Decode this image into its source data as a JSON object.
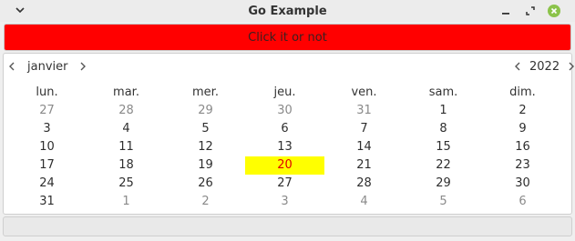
{
  "window": {
    "title": "Go Example"
  },
  "button": {
    "label": "Click it or not",
    "color": "#ff0000"
  },
  "calendar": {
    "month": "janvier",
    "year": "2022",
    "weekdays": [
      "lun.",
      "mar.",
      "mer.",
      "jeu.",
      "ven.",
      "sam.",
      "dim."
    ],
    "weeks": [
      [
        {
          "d": "27",
          "o": true
        },
        {
          "d": "28",
          "o": true
        },
        {
          "d": "29",
          "o": true
        },
        {
          "d": "30",
          "o": true
        },
        {
          "d": "31",
          "o": true
        },
        {
          "d": "1"
        },
        {
          "d": "2"
        }
      ],
      [
        {
          "d": "3"
        },
        {
          "d": "4"
        },
        {
          "d": "5"
        },
        {
          "d": "6"
        },
        {
          "d": "7"
        },
        {
          "d": "8"
        },
        {
          "d": "9"
        }
      ],
      [
        {
          "d": "10"
        },
        {
          "d": "11"
        },
        {
          "d": "12"
        },
        {
          "d": "13"
        },
        {
          "d": "14"
        },
        {
          "d": "15"
        },
        {
          "d": "16"
        }
      ],
      [
        {
          "d": "17"
        },
        {
          "d": "18"
        },
        {
          "d": "19"
        },
        {
          "d": "20",
          "today": true
        },
        {
          "d": "21"
        },
        {
          "d": "22"
        },
        {
          "d": "23"
        }
      ],
      [
        {
          "d": "24"
        },
        {
          "d": "25"
        },
        {
          "d": "26"
        },
        {
          "d": "27"
        },
        {
          "d": "28"
        },
        {
          "d": "29"
        },
        {
          "d": "30"
        }
      ],
      [
        {
          "d": "31"
        },
        {
          "d": "1",
          "o": true
        },
        {
          "d": "2",
          "o": true
        },
        {
          "d": "3",
          "o": true
        },
        {
          "d": "4",
          "o": true
        },
        {
          "d": "5",
          "o": true
        },
        {
          "d": "6",
          "o": true
        }
      ]
    ],
    "today_color": "#ffff00",
    "today_text_color": "#e00000"
  },
  "icons": {
    "menu": "chevron-down-icon",
    "minimize": "minimize-icon",
    "restore": "restore-icon",
    "close": "close-icon",
    "prev": "chevron-left-icon",
    "next": "chevron-right-icon"
  }
}
